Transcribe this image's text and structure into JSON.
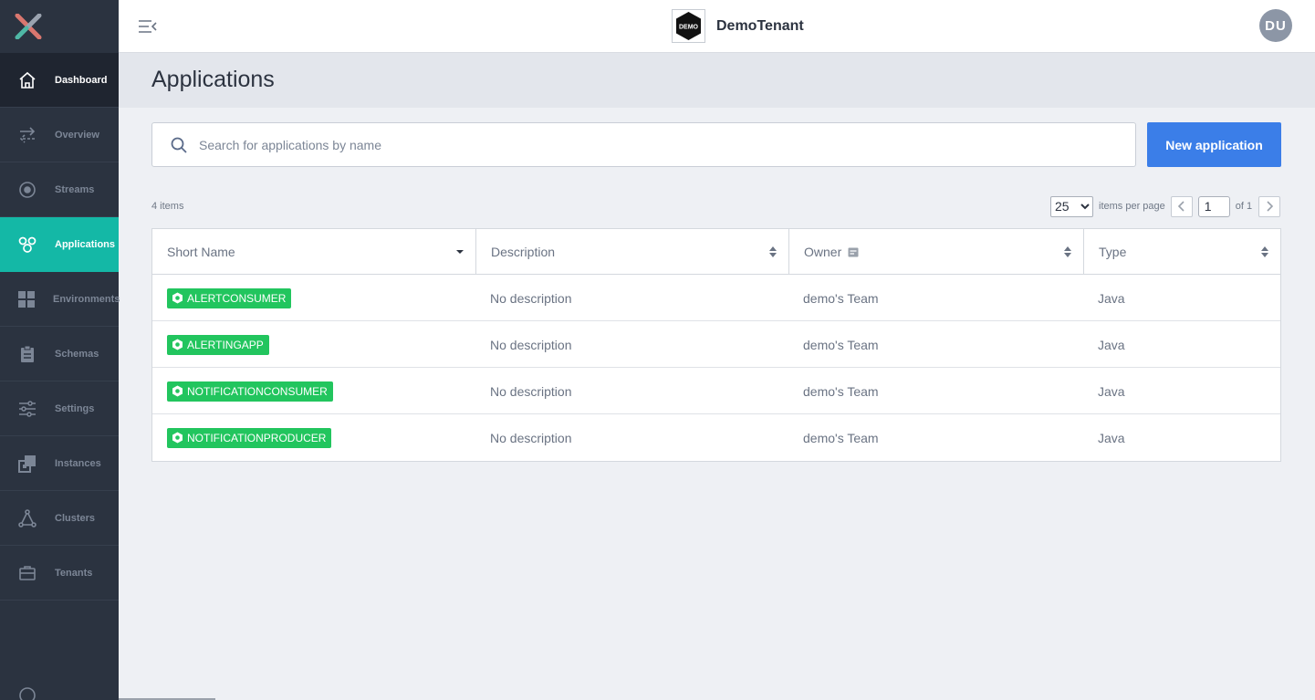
{
  "sidebar": {
    "items": [
      {
        "label": "Dashboard",
        "icon": "home-icon"
      },
      {
        "label": "Overview",
        "icon": "arrows-exchange-icon"
      },
      {
        "label": "Streams",
        "icon": "target-icon"
      },
      {
        "label": "Applications",
        "icon": "applications-icon"
      },
      {
        "label": "Environments",
        "icon": "grid-icon"
      },
      {
        "label": "Schemas",
        "icon": "clipboard-icon"
      },
      {
        "label": "Settings",
        "icon": "sliders-icon"
      },
      {
        "label": "Instances",
        "icon": "instances-icon"
      },
      {
        "label": "Clusters",
        "icon": "triangle-nodes-icon"
      },
      {
        "label": "Tenants",
        "icon": "briefcase-icon"
      }
    ],
    "active": "Applications"
  },
  "header": {
    "tenant_logo_text": "DEMO",
    "tenant_name": "DemoTenant",
    "avatar_initials": "DU"
  },
  "page": {
    "title": "Applications"
  },
  "search": {
    "placeholder": "Search for applications by name",
    "value": ""
  },
  "actions": {
    "new_application": "New application"
  },
  "list": {
    "items_count": "4 items"
  },
  "pagination": {
    "page_size": "25",
    "page_size_options": [
      "25"
    ],
    "items_per_page_label": "items per page",
    "current_page": "1",
    "of_label": "of 1"
  },
  "table": {
    "columns": {
      "short_name": "Short Name",
      "description": "Description",
      "owner": "Owner",
      "type": "Type"
    },
    "rows": [
      {
        "name": "ALERTCONSUMER",
        "description": "No description",
        "owner": "demo's Team",
        "type": "Java"
      },
      {
        "name": "ALERTINGAPP",
        "description": "No description",
        "owner": "demo's Team",
        "type": "Java"
      },
      {
        "name": "NOTIFICATIONCONSUMER",
        "description": "No description",
        "owner": "demo's Team",
        "type": "Java"
      },
      {
        "name": "NOTIFICATIONPRODUCER",
        "description": "No description",
        "owner": "demo's Team",
        "type": "Java"
      }
    ]
  },
  "colors": {
    "sidebar_bg": "#2b3340",
    "active_nav": "#14b8a6",
    "primary_button": "#3b7ee8",
    "badge_green": "#22c55e"
  }
}
